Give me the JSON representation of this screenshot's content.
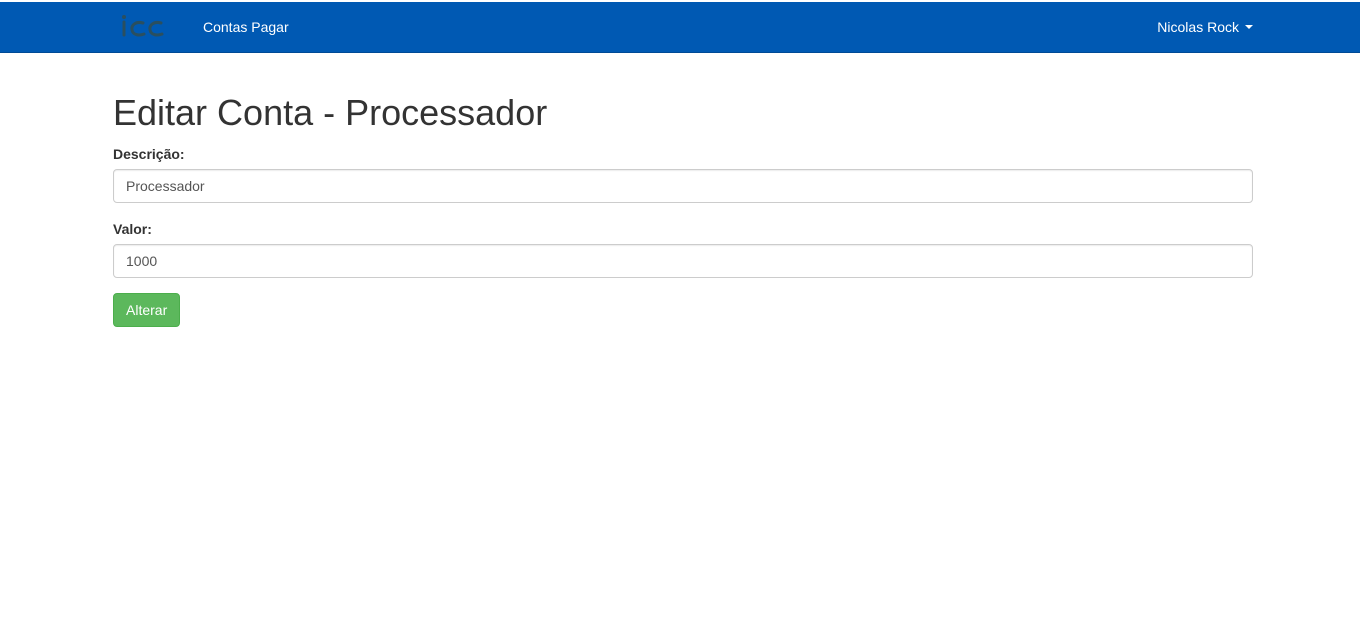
{
  "navbar": {
    "brand_logo": "icc-logo",
    "link_label": "Contas Pagar",
    "user_name": "Nicolas Rock",
    "background": "#0059b3"
  },
  "page": {
    "title": "Editar Conta - Processador"
  },
  "form": {
    "descricao_label": "Descrição:",
    "descricao_value": "Processador",
    "valor_label": "Valor:",
    "valor_value": "1000",
    "submit_label": "Alterar",
    "submit_color": "#5cb85c"
  }
}
